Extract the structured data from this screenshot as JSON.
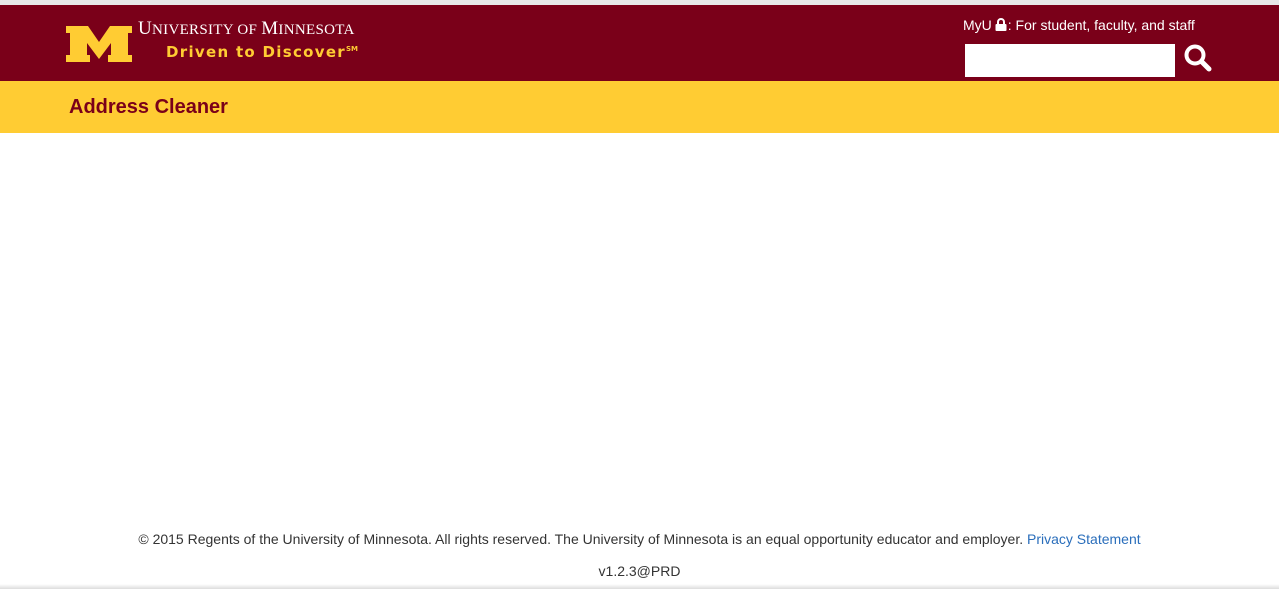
{
  "header": {
    "university_name_parts": [
      "U",
      "NIVERSITY OF ",
      "M",
      "INNESOTA"
    ],
    "tagline": "Driven to Discover",
    "tagline_mark": "SM",
    "myu_label": "MyU",
    "myu_suffix": ": For student, faculty, and staff",
    "search": {
      "value": "",
      "placeholder": ""
    },
    "icons": {
      "logo": "block-m-logo",
      "lock": "lock-icon",
      "search": "search-icon"
    },
    "colors": {
      "maroon": "#7a0019",
      "gold": "#ffcc33"
    }
  },
  "title_bar": {
    "title": "Address Cleaner"
  },
  "footer": {
    "copyright": "© 2015 Regents of the University of Minnesota. All rights reserved. The University of Minnesota is an equal opportunity educator and employer.",
    "privacy_link": "Privacy Statement",
    "version": "v1.2.3@PRD"
  }
}
